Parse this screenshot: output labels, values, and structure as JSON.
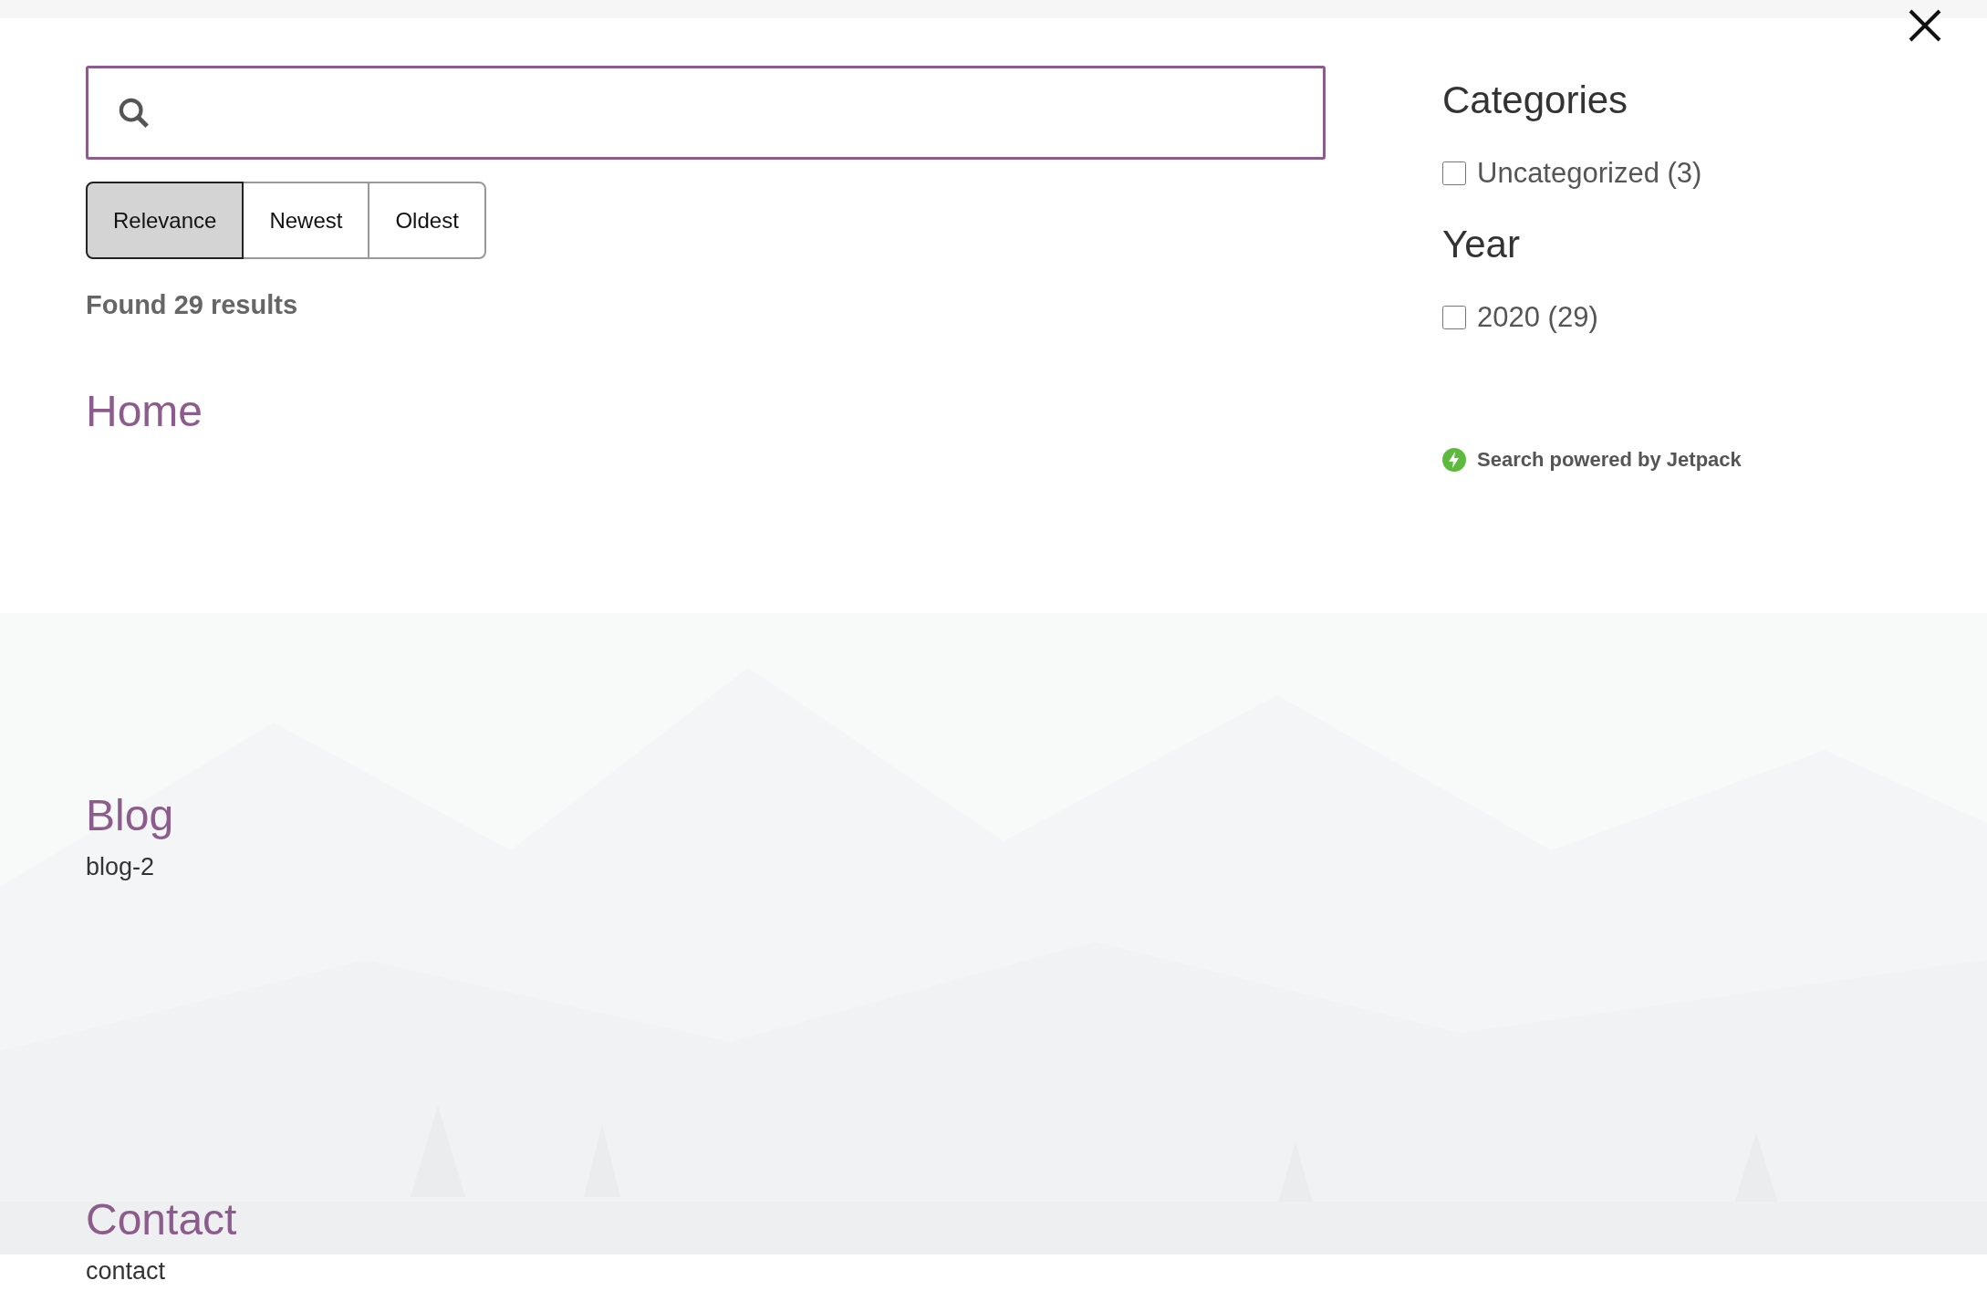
{
  "search_overlay": {
    "sort_options": [
      {
        "label": "Relevance",
        "selected": true
      },
      {
        "label": "Newest",
        "selected": false
      },
      {
        "label": "Oldest",
        "selected": false
      }
    ],
    "result_count": "Found 29 results",
    "results": [
      {
        "title": "Home"
      },
      {
        "title": "Blog",
        "excerpt": "blog-2"
      },
      {
        "title": "Contact",
        "excerpt": "contact"
      }
    ],
    "filters": [
      {
        "title": "Categories",
        "options": [
          {
            "label": "Uncategorized (3)",
            "checked": false
          }
        ]
      },
      {
        "title": "Year",
        "options": [
          {
            "label": "2020 (29)",
            "checked": false
          }
        ]
      }
    ],
    "footer": "Search powered by Jetpack"
  }
}
